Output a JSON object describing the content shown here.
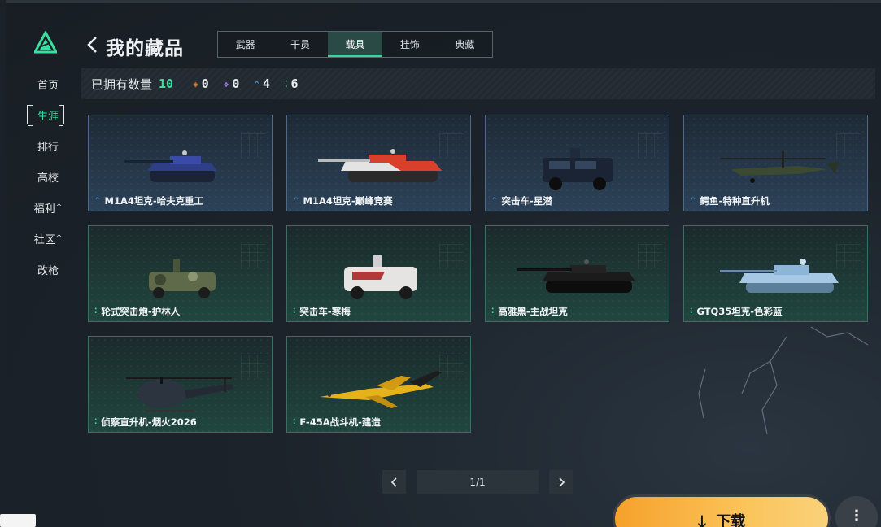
{
  "colors": {
    "accent": "#39e0a0",
    "background": "#1b2128",
    "download": "#f9b545"
  },
  "sidebar": {
    "logo_icon": "delta-logo-icon",
    "items": [
      {
        "label": "首页",
        "caret": ""
      },
      {
        "label": "生涯",
        "caret": "",
        "active": true
      },
      {
        "label": "排行",
        "caret": ""
      },
      {
        "label": "高校",
        "caret": ""
      },
      {
        "label": "福利",
        "caret": "^"
      },
      {
        "label": "社区",
        "caret": "^"
      },
      {
        "label": "改枪",
        "caret": ""
      }
    ]
  },
  "header": {
    "back_icon": "chevron-left-icon",
    "title": "我的藏品",
    "tabs": [
      "武器",
      "干员",
      "载具",
      "挂饰",
      "典藏"
    ],
    "active_tab": "载具"
  },
  "stats": {
    "owned_label": "已拥有数量",
    "owned_count": "10",
    "rarity_counts": [
      {
        "icon": "orange-diamond-icon",
        "color": "#e0873a",
        "value": "0"
      },
      {
        "icon": "purple-diamond-icon",
        "color": "#a77be8",
        "value": "0"
      },
      {
        "icon": "blue-chevron-icon",
        "color": "#4fa3ea",
        "value": "4"
      },
      {
        "icon": "green-dots-icon",
        "color": "#39e0a0",
        "value": "6"
      }
    ]
  },
  "items": [
    {
      "name": "M1A4坦克-哈夫克重工",
      "rarity": "blue",
      "art": "tank"
    },
    {
      "name": "M1A4坦克-巅峰竞赛",
      "rarity": "blue",
      "art": "tank-race"
    },
    {
      "name": "突击车-星潜",
      "rarity": "blue",
      "art": "truck-dark"
    },
    {
      "name": "鳄鱼-特种直升机",
      "rarity": "blue",
      "art": "heli-attack"
    },
    {
      "name": "轮式突击炮-护林人",
      "rarity": "green",
      "art": "truck-camo"
    },
    {
      "name": "突击车-寒梅",
      "rarity": "green",
      "art": "truck-white"
    },
    {
      "name": "高雅黑-主战坦克",
      "rarity": "green",
      "art": "tank-black"
    },
    {
      "name": "GTQ35坦克-色彩蓝",
      "rarity": "green",
      "art": "tank-blue"
    },
    {
      "name": "侦察直升机-烟火2026",
      "rarity": "green",
      "art": "heli-scout"
    },
    {
      "name": "F-45A战斗机-建造",
      "rarity": "green",
      "art": "jet"
    }
  ],
  "pagination": {
    "page_label": "1/1",
    "prev_icon": "chevron-left-icon",
    "next_icon": "chevron-right-icon"
  },
  "download": {
    "label": "下载",
    "icon": "download-arrow-icon"
  },
  "more": {
    "icon": "more-vertical-icon",
    "label": "⋮"
  }
}
